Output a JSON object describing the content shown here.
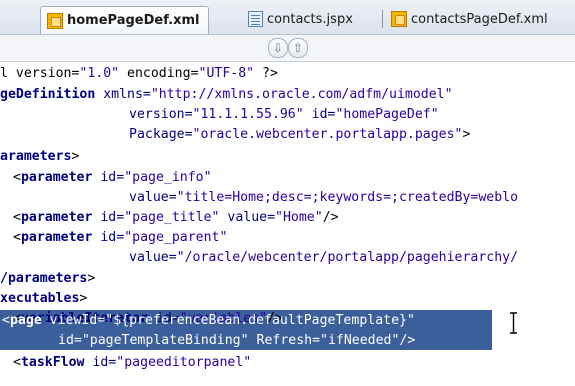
{
  "tabs": [
    {
      "label": "homePageDef.xml",
      "icon": "xml-file-icon",
      "active": true
    },
    {
      "label": "contacts.jspx",
      "icon": "jspx-file-icon",
      "active": false
    },
    {
      "label": "contactsPageDef.xml",
      "icon": "xml-file-icon",
      "active": false
    }
  ],
  "nav": {
    "down_glyph": "⇩",
    "up_glyph": "⇧"
  },
  "code": {
    "l1": {
      "a": "l version=",
      "b": "\"1.0\"",
      "c": " encoding=",
      "d": "\"UTF-8\"",
      "e": " ?>"
    },
    "l2": {
      "a": "geDefinition",
      "b": " xmlns=",
      "c": "\"http://xmlns.oracle.com/adfm/uimodel\""
    },
    "l3": {
      "a": "version=",
      "b": "\"11.1.1.55.96\"",
      "c": " id=",
      "d": "\"homePageDef\""
    },
    "l4": {
      "a": "Package=",
      "b": "\"oracle.webcenter.portalapp.pages\"",
      "c": ">"
    },
    "l5": {
      "a": "arameters",
      "b": ">"
    },
    "l6": {
      "a": "<",
      "b": "parameter",
      "c": " id=",
      "d": "\"page_info\""
    },
    "l7": {
      "a": "value=",
      "b": "\"title=Home;desc=;keywords=;createdBy=weblo"
    },
    "l8": {
      "a": "<",
      "b": "parameter",
      "c": " id=",
      "d": "\"page_title\"",
      "e": " value=",
      "f": "\"Home\"",
      "g": "/>"
    },
    "l9": {
      "a": "<",
      "b": "parameter",
      "c": " id=",
      "d": "\"page_parent\""
    },
    "l10": {
      "a": "value=",
      "b": "\"/oracle/webcenter/portalapp/pagehierarchy/"
    },
    "l11": {
      "a": "/parameters",
      "b": ">"
    },
    "l12": {
      "a": "xecutables",
      "b": ">"
    },
    "l13": {
      "a": "<",
      "b": "variableIterator",
      "c": " id=",
      "d": "\"variables\"",
      "e": "/>"
    },
    "l14": {
      "a": "<",
      "b": "page",
      "c": " viewId=",
      "d": "\"${preferenceBean.defaultPageTemplate}\""
    },
    "l15": {
      "a": "id=",
      "b": "\"pageTemplateBinding\"",
      "c": " Refresh=",
      "d": "\"ifNeeded\"",
      "e": "/>"
    },
    "l16": {
      "a": "<",
      "b": "taskFlow",
      "c": " id=",
      "d": "\"pageeditorpanel\""
    }
  },
  "colors": {
    "tag": "#000080",
    "value": "#2a00a0",
    "selection": "#3a5f9a"
  }
}
